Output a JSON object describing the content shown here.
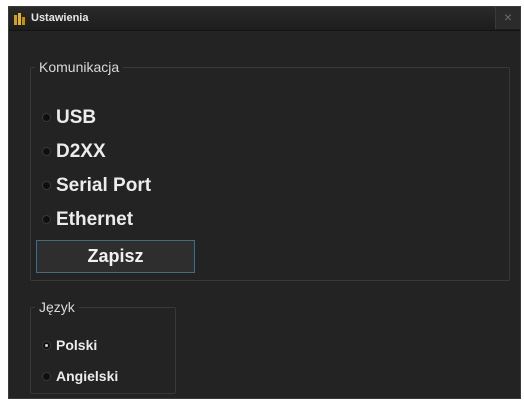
{
  "window": {
    "title": "Ustawienia",
    "close_symbol": "×"
  },
  "communication": {
    "legend": "Komunikacja",
    "options": [
      {
        "label": "USB",
        "selected": false
      },
      {
        "label": "D2XX",
        "selected": false
      },
      {
        "label": "Serial Port",
        "selected": false
      },
      {
        "label": "Ethernet",
        "selected": false
      }
    ],
    "save_label": "Zapisz"
  },
  "language": {
    "legend": "Język",
    "options": [
      {
        "label": "Polski",
        "selected": true
      },
      {
        "label": "Angielski",
        "selected": false
      }
    ]
  },
  "colors": {
    "background": "#232323",
    "text": "#ececec",
    "button_border": "#4a6a78"
  },
  "icons": {
    "app": "app-logo-icon",
    "close": "close-icon"
  }
}
